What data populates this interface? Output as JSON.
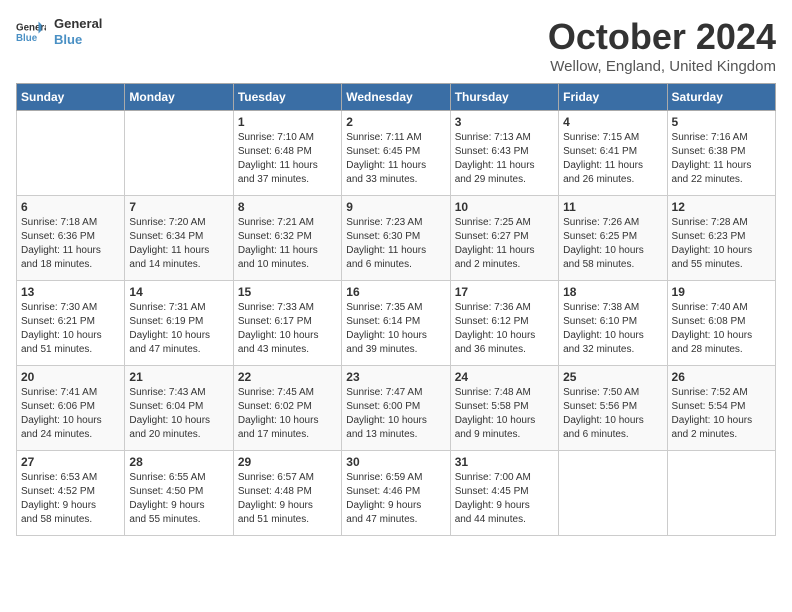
{
  "logo": {
    "line1": "General",
    "line2": "Blue"
  },
  "title": "October 2024",
  "location": "Wellow, England, United Kingdom",
  "days_of_week": [
    "Sunday",
    "Monday",
    "Tuesday",
    "Wednesday",
    "Thursday",
    "Friday",
    "Saturday"
  ],
  "weeks": [
    [
      {
        "day": "",
        "info": ""
      },
      {
        "day": "",
        "info": ""
      },
      {
        "day": "1",
        "info": "Sunrise: 7:10 AM\nSunset: 6:48 PM\nDaylight: 11 hours\nand 37 minutes."
      },
      {
        "day": "2",
        "info": "Sunrise: 7:11 AM\nSunset: 6:45 PM\nDaylight: 11 hours\nand 33 minutes."
      },
      {
        "day": "3",
        "info": "Sunrise: 7:13 AM\nSunset: 6:43 PM\nDaylight: 11 hours\nand 29 minutes."
      },
      {
        "day": "4",
        "info": "Sunrise: 7:15 AM\nSunset: 6:41 PM\nDaylight: 11 hours\nand 26 minutes."
      },
      {
        "day": "5",
        "info": "Sunrise: 7:16 AM\nSunset: 6:38 PM\nDaylight: 11 hours\nand 22 minutes."
      }
    ],
    [
      {
        "day": "6",
        "info": "Sunrise: 7:18 AM\nSunset: 6:36 PM\nDaylight: 11 hours\nand 18 minutes."
      },
      {
        "day": "7",
        "info": "Sunrise: 7:20 AM\nSunset: 6:34 PM\nDaylight: 11 hours\nand 14 minutes."
      },
      {
        "day": "8",
        "info": "Sunrise: 7:21 AM\nSunset: 6:32 PM\nDaylight: 11 hours\nand 10 minutes."
      },
      {
        "day": "9",
        "info": "Sunrise: 7:23 AM\nSunset: 6:30 PM\nDaylight: 11 hours\nand 6 minutes."
      },
      {
        "day": "10",
        "info": "Sunrise: 7:25 AM\nSunset: 6:27 PM\nDaylight: 11 hours\nand 2 minutes."
      },
      {
        "day": "11",
        "info": "Sunrise: 7:26 AM\nSunset: 6:25 PM\nDaylight: 10 hours\nand 58 minutes."
      },
      {
        "day": "12",
        "info": "Sunrise: 7:28 AM\nSunset: 6:23 PM\nDaylight: 10 hours\nand 55 minutes."
      }
    ],
    [
      {
        "day": "13",
        "info": "Sunrise: 7:30 AM\nSunset: 6:21 PM\nDaylight: 10 hours\nand 51 minutes."
      },
      {
        "day": "14",
        "info": "Sunrise: 7:31 AM\nSunset: 6:19 PM\nDaylight: 10 hours\nand 47 minutes."
      },
      {
        "day": "15",
        "info": "Sunrise: 7:33 AM\nSunset: 6:17 PM\nDaylight: 10 hours\nand 43 minutes."
      },
      {
        "day": "16",
        "info": "Sunrise: 7:35 AM\nSunset: 6:14 PM\nDaylight: 10 hours\nand 39 minutes."
      },
      {
        "day": "17",
        "info": "Sunrise: 7:36 AM\nSunset: 6:12 PM\nDaylight: 10 hours\nand 36 minutes."
      },
      {
        "day": "18",
        "info": "Sunrise: 7:38 AM\nSunset: 6:10 PM\nDaylight: 10 hours\nand 32 minutes."
      },
      {
        "day": "19",
        "info": "Sunrise: 7:40 AM\nSunset: 6:08 PM\nDaylight: 10 hours\nand 28 minutes."
      }
    ],
    [
      {
        "day": "20",
        "info": "Sunrise: 7:41 AM\nSunset: 6:06 PM\nDaylight: 10 hours\nand 24 minutes."
      },
      {
        "day": "21",
        "info": "Sunrise: 7:43 AM\nSunset: 6:04 PM\nDaylight: 10 hours\nand 20 minutes."
      },
      {
        "day": "22",
        "info": "Sunrise: 7:45 AM\nSunset: 6:02 PM\nDaylight: 10 hours\nand 17 minutes."
      },
      {
        "day": "23",
        "info": "Sunrise: 7:47 AM\nSunset: 6:00 PM\nDaylight: 10 hours\nand 13 minutes."
      },
      {
        "day": "24",
        "info": "Sunrise: 7:48 AM\nSunset: 5:58 PM\nDaylight: 10 hours\nand 9 minutes."
      },
      {
        "day": "25",
        "info": "Sunrise: 7:50 AM\nSunset: 5:56 PM\nDaylight: 10 hours\nand 6 minutes."
      },
      {
        "day": "26",
        "info": "Sunrise: 7:52 AM\nSunset: 5:54 PM\nDaylight: 10 hours\nand 2 minutes."
      }
    ],
    [
      {
        "day": "27",
        "info": "Sunrise: 6:53 AM\nSunset: 4:52 PM\nDaylight: 9 hours\nand 58 minutes."
      },
      {
        "day": "28",
        "info": "Sunrise: 6:55 AM\nSunset: 4:50 PM\nDaylight: 9 hours\nand 55 minutes."
      },
      {
        "day": "29",
        "info": "Sunrise: 6:57 AM\nSunset: 4:48 PM\nDaylight: 9 hours\nand 51 minutes."
      },
      {
        "day": "30",
        "info": "Sunrise: 6:59 AM\nSunset: 4:46 PM\nDaylight: 9 hours\nand 47 minutes."
      },
      {
        "day": "31",
        "info": "Sunrise: 7:00 AM\nSunset: 4:45 PM\nDaylight: 9 hours\nand 44 minutes."
      },
      {
        "day": "",
        "info": ""
      },
      {
        "day": "",
        "info": ""
      }
    ]
  ]
}
